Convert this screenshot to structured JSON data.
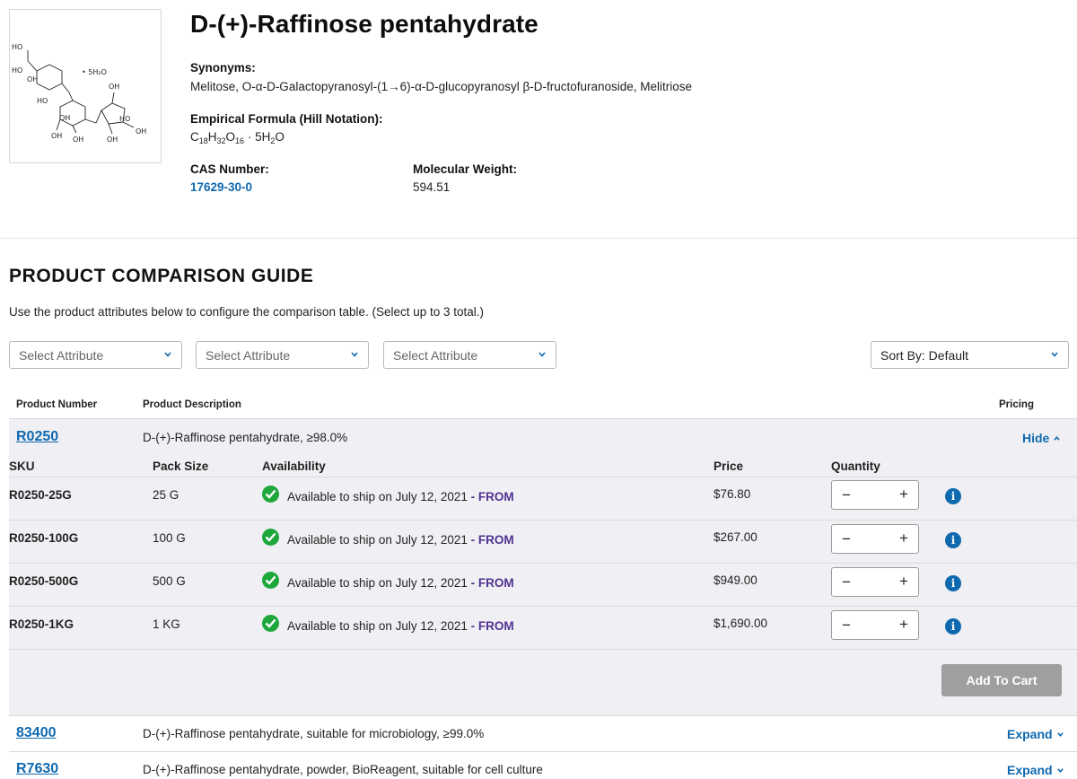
{
  "product": {
    "title": "D-(+)-Raffinose pentahydrate",
    "synonyms_label": "Synonyms:",
    "synonyms": "Melitose, O-α-D-Galactopyranosyl-(1→6)-α-D-glucopyranosyl β-D-fructofuranoside, Melitriose",
    "formula_label": "Empirical Formula (Hill Notation):",
    "formula": "C18H32O16 · 5H2O",
    "cas_label": "CAS Number:",
    "cas": "17629-30-0",
    "mw_label": "Molecular Weight:",
    "mw": "594.51",
    "structure_labels": {
      "hydrate": "• 5H₂O",
      "ho1": "HO",
      "ho2": "HO",
      "oh1": "OH",
      "ho3": "HO",
      "oh2": "OH",
      "oh3": "OH",
      "oh4": "OH",
      "oh5": "OH",
      "ho4": "HO",
      "oh6": "OH",
      "oh7": "OH"
    }
  },
  "guide": {
    "title": "PRODUCT COMPARISON GUIDE",
    "intro": "Use the product attributes below to configure the comparison table. (Select up to 3 total.)",
    "selects": [
      "Select Attribute",
      "Select Attribute",
      "Select Attribute"
    ],
    "sort": "Sort By: Default"
  },
  "table": {
    "headers": {
      "number": "Product Number",
      "description": "Product Description",
      "pricing": "Pricing"
    },
    "sub_headers": {
      "sku": "SKU",
      "pack": "Pack Size",
      "availability": "Availability",
      "price": "Price",
      "quantity": "Quantity"
    },
    "groups": [
      {
        "number": "R0250",
        "description": "D-(+)-Raffinose pentahydrate, ≥98.0%",
        "toggle": "Hide",
        "expanded": true,
        "skus": [
          {
            "sku": "R0250-25G",
            "pack": "25 G",
            "availability": "Available to ship on July 12, 2021",
            "from": "- FROM",
            "price": "$76.80"
          },
          {
            "sku": "R0250-100G",
            "pack": "100 G",
            "availability": "Available to ship on July 12, 2021",
            "from": "- FROM",
            "price": "$267.00"
          },
          {
            "sku": "R0250-500G",
            "pack": "500 G",
            "availability": "Available to ship on July 12, 2021",
            "from": "- FROM",
            "price": "$949.00"
          },
          {
            "sku": "R0250-1KG",
            "pack": "1 KG",
            "availability": "Available to ship on July 12, 2021",
            "from": "- FROM",
            "price": "$1,690.00"
          }
        ],
        "add_to_cart": "Add To Cart"
      },
      {
        "number": "83400",
        "description": "D-(+)-Raffinose pentahydrate, suitable for microbiology, ≥99.0%",
        "toggle": "Expand",
        "expanded": false
      },
      {
        "number": "R7630",
        "description": "D-(+)-Raffinose pentahydrate, powder, BioReagent, suitable for cell culture",
        "toggle": "Expand",
        "expanded": false
      }
    ],
    "stepper": {
      "minus": "−",
      "plus": "+"
    },
    "info_glyph": "i"
  },
  "colors": {
    "link": "#0f69af",
    "from": "#503291",
    "check": "#1ea83c",
    "band": "#f0f0f4",
    "button": "#9f9f9f"
  },
  "icons": [
    "chevron-down-icon",
    "chevron-up-icon",
    "check-circle-icon",
    "info-icon"
  ]
}
